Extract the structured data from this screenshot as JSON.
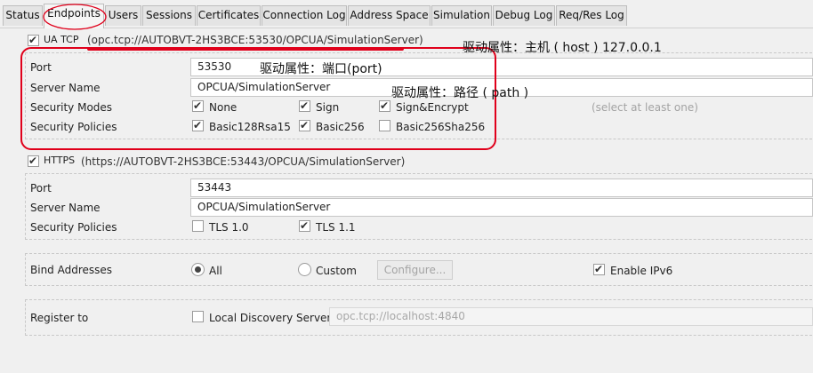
{
  "tabs": [
    "Status",
    "Endpoints",
    "Users",
    "Sessions",
    "Certificates",
    "Connection Log",
    "Address Space",
    "Simulation",
    "Debug Log",
    "Req/Res Log"
  ],
  "ua_tcp": {
    "label": "UA TCP",
    "url": "(opc.tcp://AUTOBVT-2HS3BCE:53530/OPCUA/SimulationServer)",
    "port_label": "Port",
    "port_value": "53530",
    "server_name_label": "Server Name",
    "server_name_value": "OPCUA/SimulationServer",
    "security_modes_label": "Security Modes",
    "modes": [
      "None",
      "Sign",
      "Sign&Encrypt"
    ],
    "modes_hint": "(select at least one)",
    "security_policies_label": "Security Policies",
    "policies": [
      "Basic128Rsa15",
      "Basic256",
      "Basic256Sha256"
    ]
  },
  "https": {
    "label": "HTTPS",
    "url": "(https://AUTOBVT-2HS3BCE:53443/OPCUA/SimulationServer)",
    "port_label": "Port",
    "port_value": "53443",
    "server_name_label": "Server Name",
    "server_name_value": "OPCUA/SimulationServer",
    "security_policies_label": "Security Policies",
    "policies": [
      "TLS 1.0",
      "TLS 1.1"
    ]
  },
  "bind": {
    "label": "Bind Addresses",
    "all": "All",
    "custom": "Custom",
    "configure": "Configure...",
    "enable_ipv6": "Enable IPv6"
  },
  "register": {
    "label": "Register to",
    "lds": "Local Discovery Server",
    "placeholder": "opc.tcp://localhost:4840"
  },
  "annotations": {
    "host": "驱动属性：主机 ( host ) 127.0.0.1",
    "port": "驱动属性：端口(port)",
    "path": "驱动属性：路径 ( path )"
  },
  "colors": {
    "annotation": "#e0001b",
    "checkbox_border": "#9b9b9b",
    "panel_border": "#c8c8c8"
  }
}
